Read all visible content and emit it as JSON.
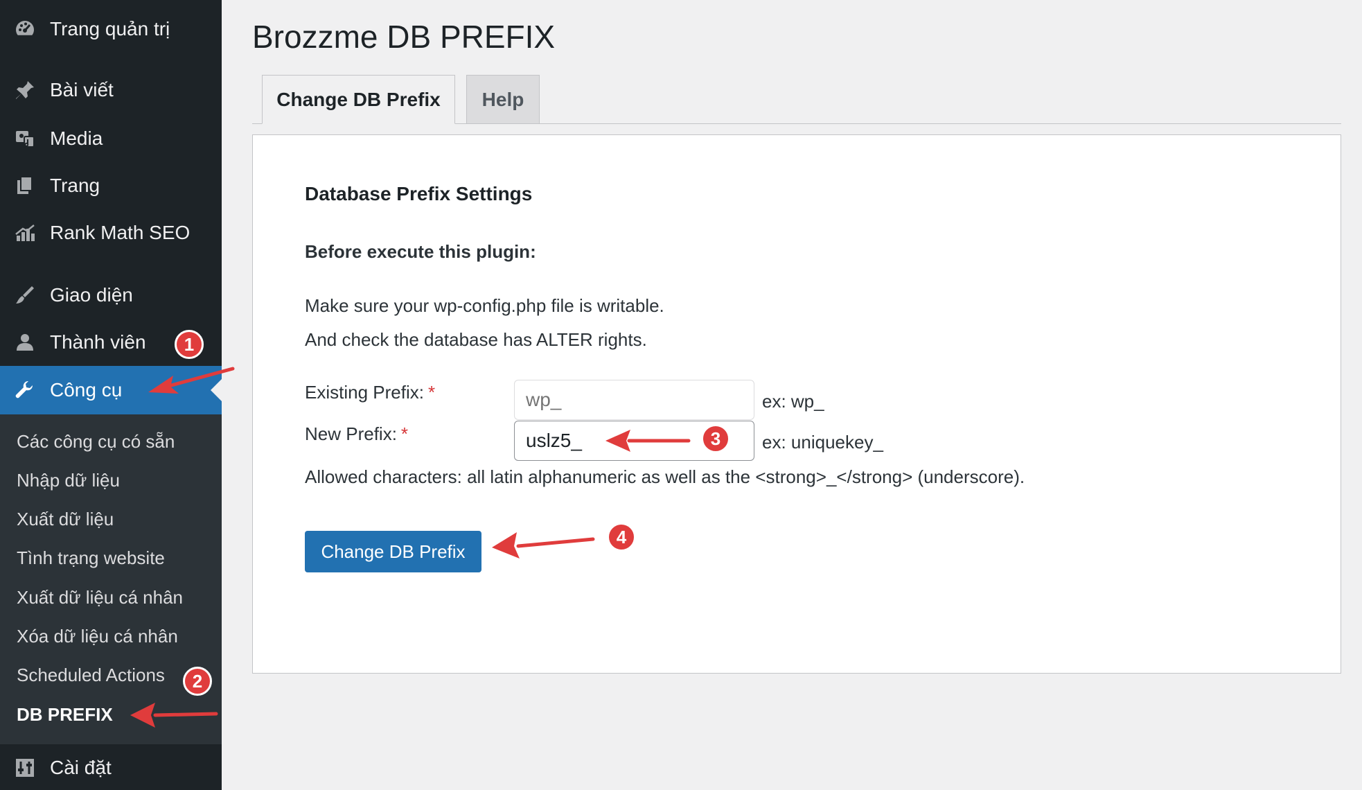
{
  "sidebar": {
    "items": [
      {
        "label": "Trang quản trị",
        "icon": "dashboard-icon"
      },
      {
        "label": "Bài viết",
        "icon": "pin-icon"
      },
      {
        "label": "Media",
        "icon": "media-icon"
      },
      {
        "label": "Trang",
        "icon": "pages-icon"
      },
      {
        "label": "Rank Math SEO",
        "icon": "chart-icon"
      },
      {
        "label": "Giao diện",
        "icon": "brush-icon"
      },
      {
        "label": "Thành viên",
        "icon": "user-icon"
      },
      {
        "label": "Công cụ",
        "icon": "wrench-icon"
      }
    ],
    "submenu": [
      "Các công cụ có sẵn",
      "Nhập dữ liệu",
      "Xuất dữ liệu",
      "Tình trạng website",
      "Xuất dữ liệu cá nhân",
      "Xóa dữ liệu cá nhân",
      "Scheduled Actions",
      "DB PREFIX"
    ],
    "settings": {
      "label": "Cài đặt",
      "icon": "settings-icon"
    }
  },
  "badges": [
    "1",
    "2",
    "3",
    "4"
  ],
  "page": {
    "title": "Brozzme DB PREFIX",
    "tabs": [
      "Change DB Prefix",
      "Help"
    ],
    "section_title": "Database Prefix Settings",
    "subhead": "Before execute this plugin:",
    "line1": "Make sure your wp-config.php file is writable.",
    "line2": "And check the database has ALTER rights.",
    "existing_label": "Existing Prefix:",
    "existing_placeholder": "wp_",
    "existing_hint": "ex: wp_",
    "new_label": "New Prefix:",
    "new_value": "uslz5_",
    "new_hint": "ex: uniquekey_",
    "required_mark": "*",
    "allowed": "Allowed characters: all latin alphanumeric as well as the <strong>_</strong> (underscore).",
    "submit_label": "Change DB Prefix"
  },
  "colors": {
    "accent": "#2271b1",
    "sidebar": "#1d2327",
    "annotation": "#e03c3c"
  }
}
